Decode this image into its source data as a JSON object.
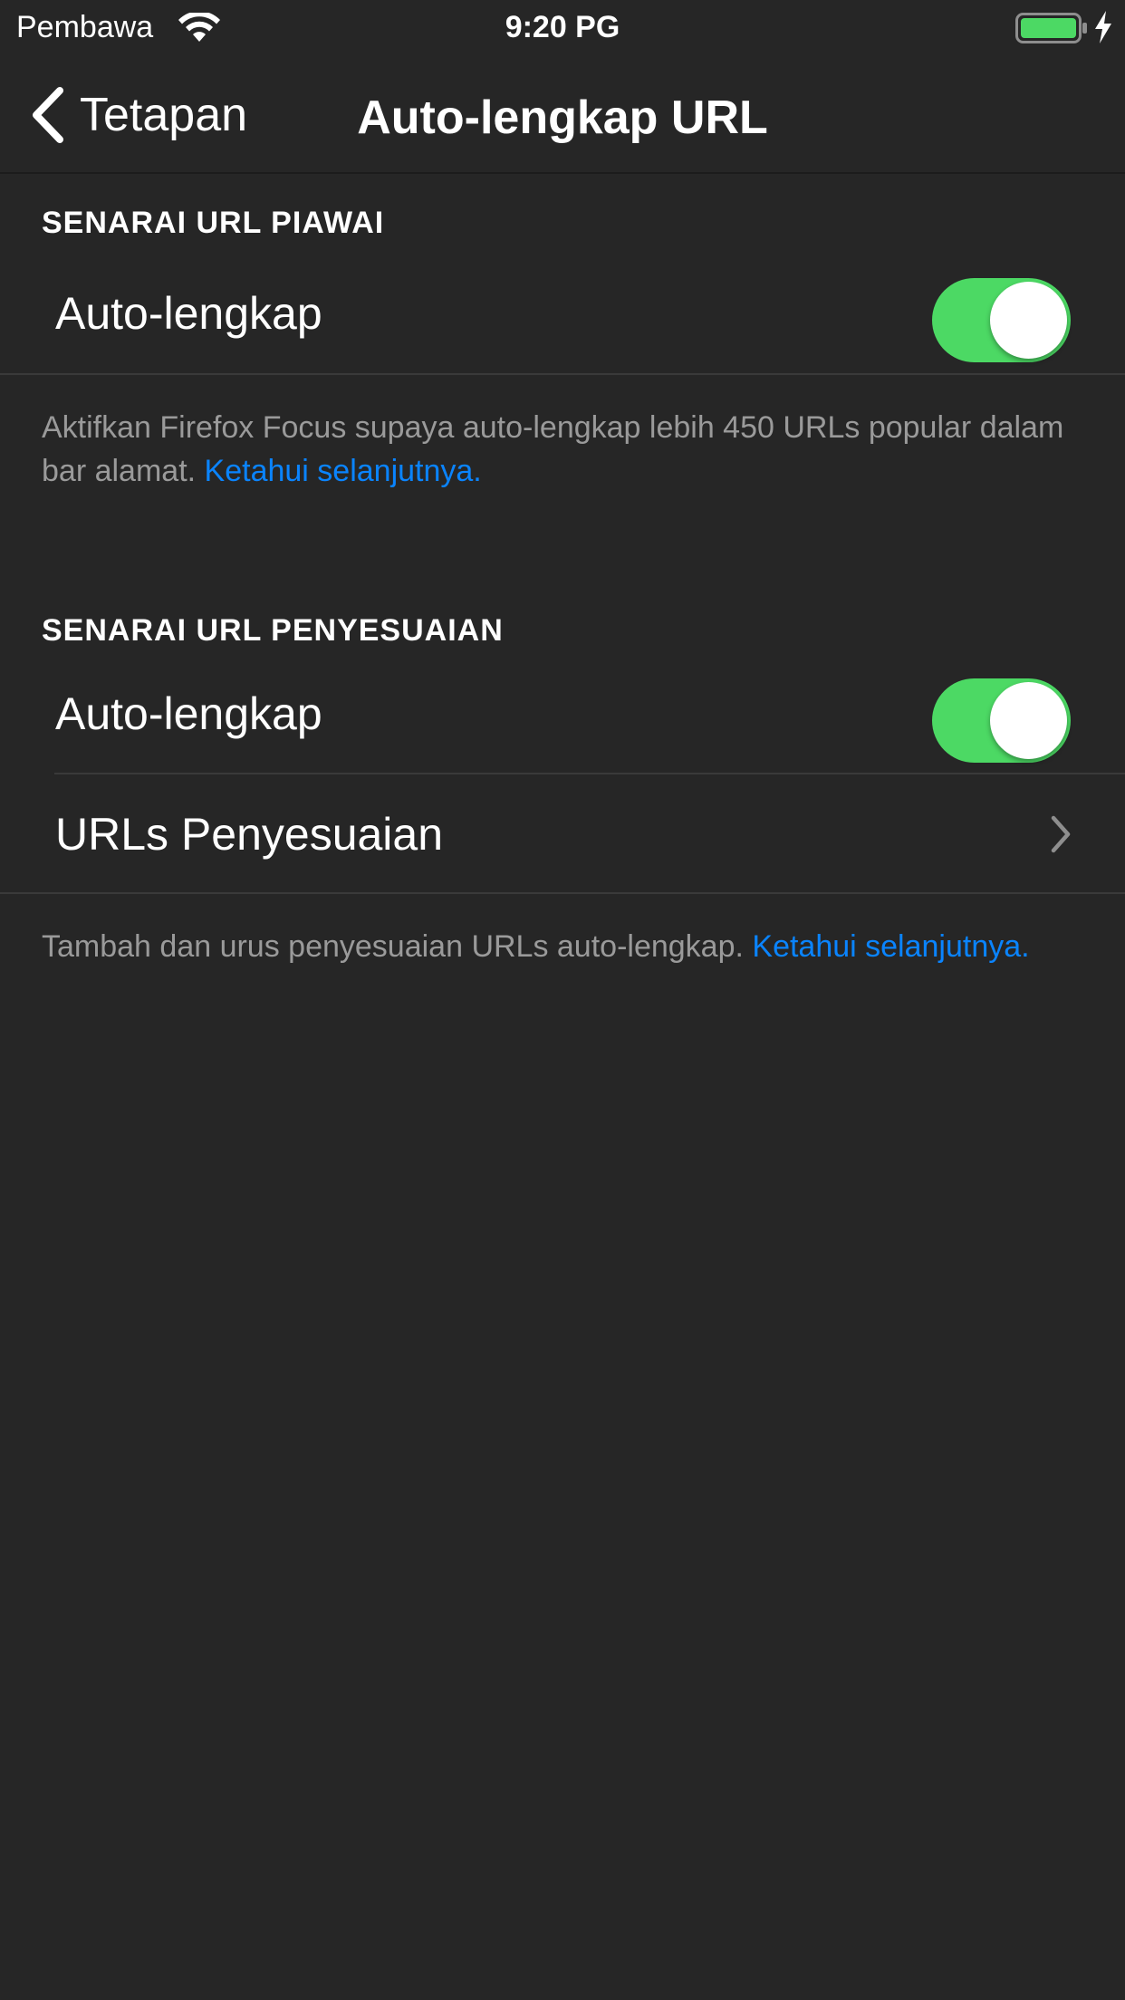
{
  "status_bar": {
    "carrier": "Pembawa",
    "time": "9:20 PG",
    "wifi_icon": "wifi-icon",
    "battery_icon": "battery-icon",
    "battery_level": 1.0,
    "charging_icon": "charging-bolt-icon"
  },
  "nav": {
    "back_label": "Tetapan",
    "back_icon": "chevron-left-icon",
    "title": "Auto-lengkap URL"
  },
  "sections": {
    "default": {
      "header": "SENARAI URL PIAWAI",
      "autocomplete_label": "Auto-lengkap",
      "autocomplete_enabled": true,
      "footer_text": "Aktifkan Firefox Focus supaya auto-lengkap lebih 450 URLs popular dalam bar alamat. ",
      "footer_link": "Ketahui selanjutnya."
    },
    "custom": {
      "header": "SENARAI URL PENYESUAIAN",
      "autocomplete_label": "Auto-lengkap",
      "autocomplete_enabled": true,
      "custom_urls_label": "URLs Penyesuaian",
      "footer_text": "Tambah dan urus penyesuaian URLs auto-lengkap. ",
      "footer_link": "Ketahui selanjutnya."
    }
  },
  "colors": {
    "background": "#262626",
    "toggle_on": "#4cd964",
    "link": "#0a84ff",
    "secondary_text": "#9a9a9a"
  }
}
